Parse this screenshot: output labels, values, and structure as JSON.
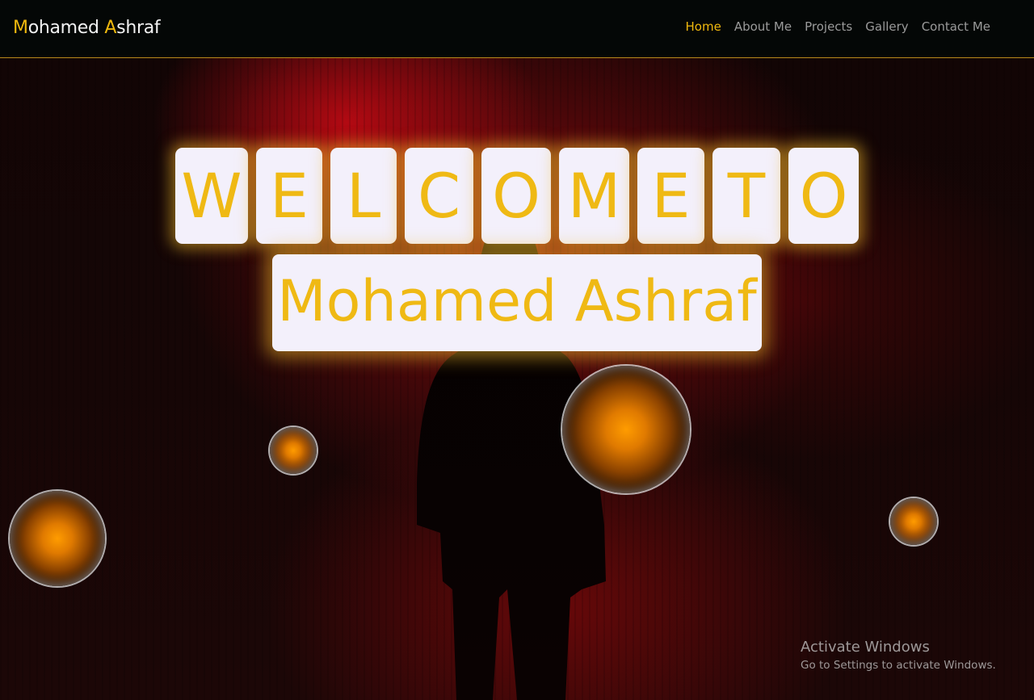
{
  "brand": {
    "first_initial": "M",
    "first_rest": "ohamed ",
    "second_initial": "A",
    "second_rest": "shraf"
  },
  "nav": {
    "items": [
      {
        "label": "Home",
        "active": true
      },
      {
        "label": "About Me",
        "active": false
      },
      {
        "label": "Projects",
        "active": false
      },
      {
        "label": "Gallery",
        "active": false
      },
      {
        "label": "Contact Me",
        "active": false
      }
    ]
  },
  "hero": {
    "welcome_letters": [
      "W",
      "E",
      "L",
      "C",
      "O",
      "M",
      "E",
      "T",
      "O"
    ],
    "name": "Mohamed Ashraf"
  },
  "watermark": {
    "title": "Activate Windows",
    "subtitle": "Go to Settings to activate Windows."
  },
  "colors": {
    "accent": "#f0b90e",
    "nav_text": "#9a9a9a",
    "tile_bg": "#f3f0fb",
    "navbar_bg": "#040706"
  }
}
